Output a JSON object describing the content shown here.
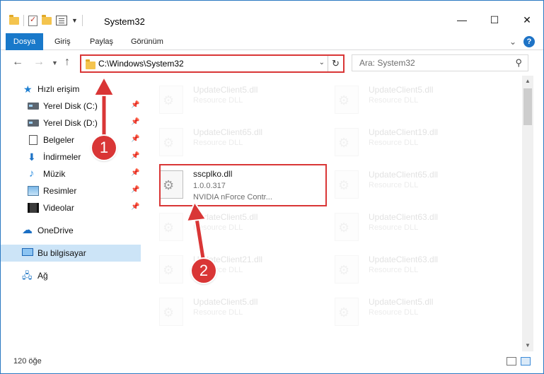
{
  "window": {
    "title": "System32"
  },
  "ribbon": {
    "tabs": [
      "Dosya",
      "Giriş",
      "Paylaş",
      "Görünüm"
    ]
  },
  "nav": {
    "address": "C:\\Windows\\System32",
    "search_placeholder": "Ara: System32"
  },
  "sidebar": {
    "items": [
      {
        "label": "Hızlı erişim",
        "icon": "star-icon"
      },
      {
        "label": "Yerel Disk (C:)",
        "icon": "disk-icon",
        "pinned": true
      },
      {
        "label": "Yerel Disk (D:)",
        "icon": "disk-icon",
        "pinned": true
      },
      {
        "label": "Belgeler",
        "icon": "documents-icon",
        "pinned": true
      },
      {
        "label": "İndirmeler",
        "icon": "download-icon",
        "pinned": true
      },
      {
        "label": "Müzik",
        "icon": "music-icon",
        "pinned": true
      },
      {
        "label": "Resimler",
        "icon": "pictures-icon",
        "pinned": true
      },
      {
        "label": "Videolar",
        "icon": "videos-icon",
        "pinned": true
      },
      {
        "label": "OneDrive",
        "icon": "cloud-icon"
      },
      {
        "label": "Bu bilgisayar",
        "icon": "computer-icon",
        "selected": true
      },
      {
        "label": "Ağ",
        "icon": "network-icon"
      }
    ]
  },
  "files": {
    "left": [
      {
        "name": "UpdateClient5.dll",
        "desc": "Resource DLL"
      },
      {
        "name": "UpdateClient65.dll",
        "desc": "Resource DLL"
      },
      {
        "name": "sscplko.dll",
        "version": "1.0.0.317",
        "desc": "NVIDIA nForce Contr..."
      },
      {
        "name": "UpdateClient5.dll",
        "desc": "Resource DLL"
      },
      {
        "name": "UpdateClient21.dll",
        "desc": "Resource DLL"
      },
      {
        "name": "UpdateClient5.dll",
        "desc": "Resource DLL"
      }
    ],
    "right": [
      {
        "name": "UpdateClient5.dll",
        "desc": "Resource DLL"
      },
      {
        "name": "UpdateClient19.dll",
        "desc": "Resource DLL"
      },
      {
        "name": "UpdateClient65.dll",
        "desc": "Resource DLL"
      },
      {
        "name": "UpdateClient63.dll",
        "desc": "Resource DLL"
      },
      {
        "name": "UpdateClient63.dll",
        "desc": "Resource DLL"
      },
      {
        "name": "UpdateClient5.dll",
        "desc": "Resource DLL"
      }
    ]
  },
  "status": {
    "item_count": "120 öğe"
  },
  "callouts": [
    "1",
    "2"
  ],
  "colors": {
    "accent": "#1979ca",
    "callout": "#d93636"
  }
}
